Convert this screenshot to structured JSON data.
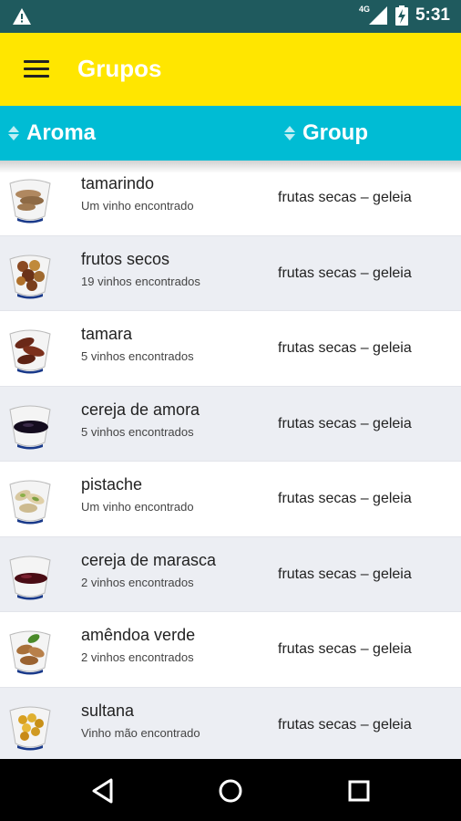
{
  "status_bar": {
    "network": "4G",
    "time": "5:31",
    "icons": [
      "warning-icon",
      "signal-icon",
      "battery-charging-icon"
    ]
  },
  "app_bar": {
    "title": "Grupos",
    "menu_icon": "hamburger-menu-icon"
  },
  "table_header": {
    "col1": "Aroma",
    "col2": "Group",
    "sort_icon": "sort-icon"
  },
  "colors": {
    "status_bar": "#1f5a5e",
    "app_bar": "#ffe600",
    "header": "#00bcd4",
    "row_alt": "#eceef3"
  },
  "rows": [
    {
      "name": "tamarindo",
      "sub": "Um vinho encontrado",
      "group": "frutas secas – geleia",
      "icon": "tamarind-icon"
    },
    {
      "name": "frutos secos",
      "sub": "19 vinhos encontrados",
      "group": "frutas secas – geleia",
      "icon": "dried-fruits-icon"
    },
    {
      "name": "tamara",
      "sub": "5 vinhos encontrados",
      "group": "frutas secas – geleia",
      "icon": "dates-icon"
    },
    {
      "name": "cereja de amora",
      "sub": "5 vinhos encontrados",
      "group": "frutas secas – geleia",
      "icon": "blackberry-jam-icon"
    },
    {
      "name": "pistache",
      "sub": "Um vinho encontrado",
      "group": "frutas secas – geleia",
      "icon": "pistachio-icon"
    },
    {
      "name": "cereja de marasca",
      "sub": "2 vinhos encontrados",
      "group": "frutas secas – geleia",
      "icon": "marasca-cherry-jam-icon"
    },
    {
      "name": "amêndoa verde",
      "sub": "2 vinhos encontrados",
      "group": "frutas secas – geleia",
      "icon": "green-almond-icon"
    },
    {
      "name": "sultana",
      "sub": "Vinho mão encontrado",
      "group": "frutas secas – geleia",
      "icon": "sultana-icon"
    }
  ],
  "nav_bar": {
    "icons": [
      "back-icon",
      "home-icon",
      "recents-icon"
    ]
  }
}
